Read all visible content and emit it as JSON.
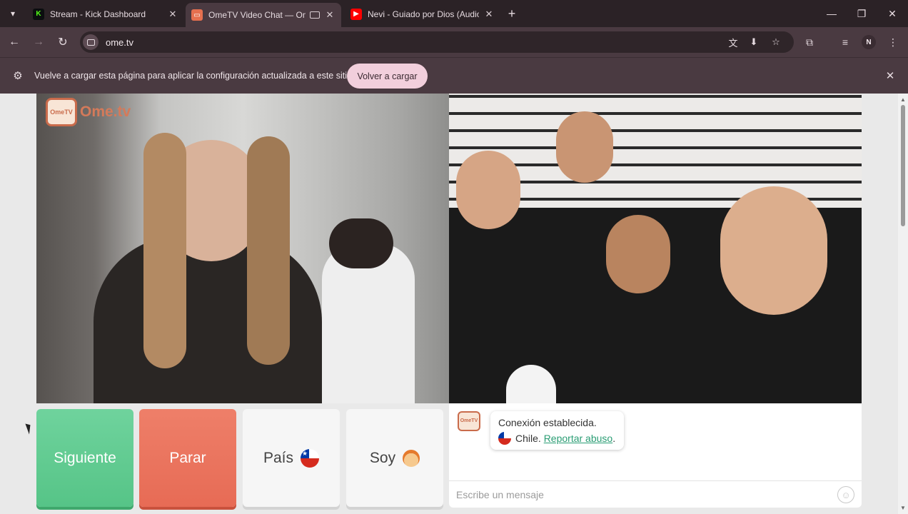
{
  "tabs": [
    {
      "title": "Stream - Kick Dashboard",
      "favicon": "kick-icon",
      "favicon_color": "#53fc18",
      "active": false
    },
    {
      "title": "OmeTV Video Chat — Ome",
      "favicon": "ometv-icon",
      "favicon_color": "#e6704f",
      "active": true
    },
    {
      "title": "Nevi - Guiado por Dios (Audio",
      "favicon": "youtube-icon",
      "favicon_color": "#ff0000",
      "active": false
    }
  ],
  "toolbar": {
    "url": "ome.tv",
    "profile_initial": "N"
  },
  "infobar": {
    "message": "Vuelve a cargar esta página para aplicar la configuración actualizada a este sitio",
    "reload_label": "Volver a cargar"
  },
  "logo": {
    "badge_top": "Ome",
    "badge_bottom": "TV",
    "text": "Ome.tv"
  },
  "controls": {
    "next_label": "Siguiente",
    "stop_label": "Parar",
    "country_label": "País",
    "me_label": "Soy"
  },
  "chat": {
    "status": "Conexión establecida.",
    "country": "Chile.",
    "report_label": "Reportar abuso",
    "report_suffix": ".",
    "input_placeholder": "Escribe un mensaje"
  },
  "colors": {
    "next_button": "#56c487",
    "stop_button": "#e76b55",
    "link": "#2a9d74",
    "brand": "#d47a5a"
  }
}
